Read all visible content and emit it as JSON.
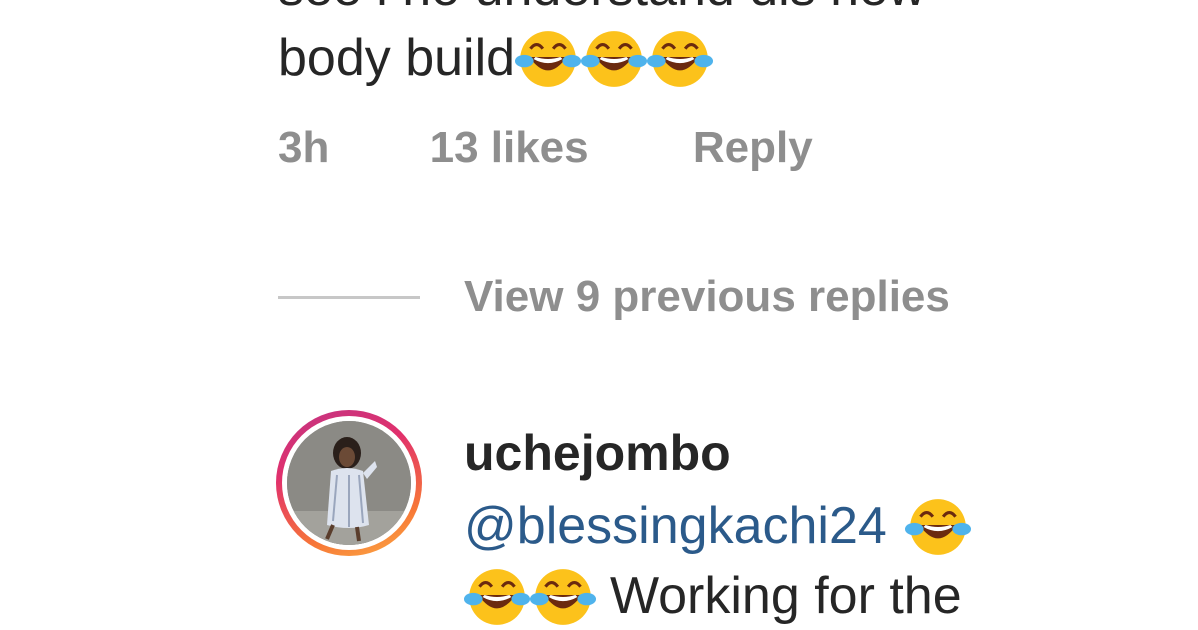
{
  "comment": {
    "line1_partial": "see i no understand dis new",
    "line2_text": "body build",
    "emojis_line2": [
      "face-with-tears-of-joy-icon",
      "face-with-tears-of-joy-icon",
      "face-with-tears-of-joy-icon"
    ],
    "time": "3h",
    "likes": "13 likes",
    "reply_label": "Reply"
  },
  "thread": {
    "view_previous_label": "View 9 previous replies"
  },
  "reply": {
    "username": "uchejombo",
    "mention": "@blessingkachi24",
    "text_partial": "Working for the",
    "emoji_icon": "face-with-tears-of-joy-icon"
  },
  "colors": {
    "text": "#262626",
    "meta_gray": "#8e8e8e",
    "mention_blue": "#2b5a8a",
    "story_ring_start": "#c13584",
    "story_ring_end": "#fcaf45"
  }
}
